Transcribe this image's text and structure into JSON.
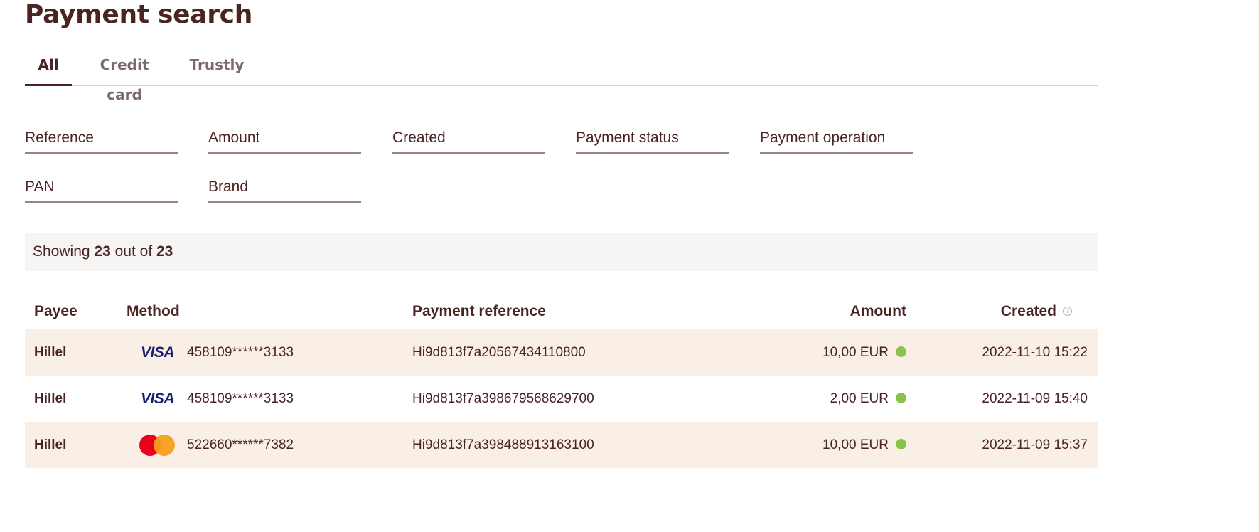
{
  "page": {
    "title": "Payment search"
  },
  "tabs": [
    {
      "label": "All",
      "active": true
    },
    {
      "label": "Credit card",
      "active": false
    },
    {
      "label": "Trustly",
      "active": false
    }
  ],
  "filters": {
    "reference": "Reference",
    "amount": "Amount",
    "created": "Created",
    "payment_status": "Payment status",
    "payment_operation": "Payment operation",
    "pan": "PAN",
    "brand": "Brand"
  },
  "summary": {
    "prefix": "Showing",
    "shown": "23",
    "middle": "out of",
    "total": "23"
  },
  "table": {
    "columns": {
      "payee": "Payee",
      "method": "Method",
      "payment_reference": "Payment reference",
      "amount": "Amount",
      "created": "Created"
    },
    "rows": [
      {
        "payee": "Hillel",
        "brand_icon": "visa-logo",
        "brand_text": "VISA",
        "pan": "458109******3133",
        "reference": "Hi9d813f7a20567434110800",
        "amount": "10,00 EUR",
        "status_color": "#8bc34a",
        "created": "2022-11-10 15:22"
      },
      {
        "payee": "Hillel",
        "brand_icon": "visa-logo",
        "brand_text": "VISA",
        "pan": "458109******3133",
        "reference": "Hi9d813f7a398679568629700",
        "amount": "2,00 EUR",
        "status_color": "#8bc34a",
        "created": "2022-11-09 15:40"
      },
      {
        "payee": "Hillel",
        "brand_icon": "mastercard-logo",
        "brand_text": "",
        "pan": "522660******7382",
        "reference": "Hi9d813f7a398488913163100",
        "amount": "10,00 EUR",
        "status_color": "#8bc34a",
        "created": "2022-11-09 15:37"
      }
    ]
  }
}
